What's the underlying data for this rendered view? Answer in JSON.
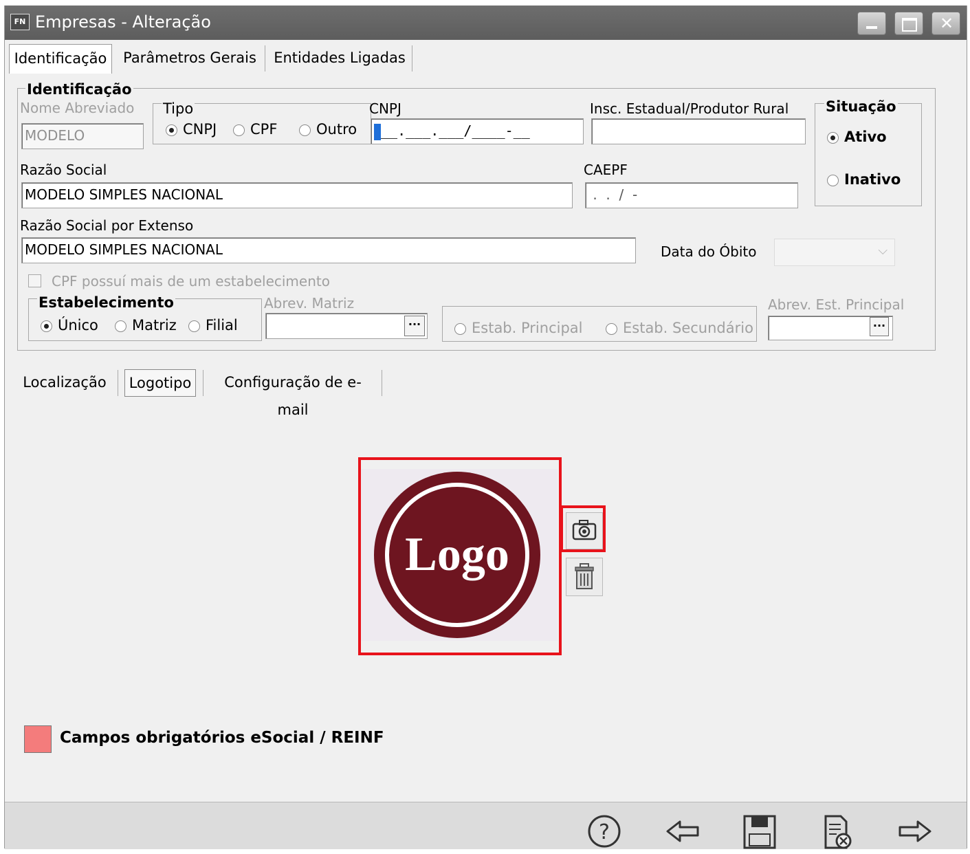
{
  "window": {
    "title": "Empresas - Alteração",
    "app_icon": "FN"
  },
  "tabs": [
    "Identificação",
    "Parâmetros Gerais",
    "Entidades Ligadas"
  ],
  "identificacao": {
    "legend": "Identificação",
    "nome_abreviado_label": "Nome Abreviado",
    "nome_abreviado_value": "MODELO",
    "tipo": {
      "legend": "Tipo",
      "options": [
        "CNPJ",
        "CPF",
        "Outro"
      ],
      "selected": "CNPJ"
    },
    "cnpj_label": "CNPJ",
    "cnpj_value": "__.___.___/____-__",
    "insc_label": "Insc. Estadual/Produtor Rural",
    "insc_value": "",
    "razao_label": "Razão Social",
    "razao_value": "MODELO SIMPLES NACIONAL",
    "caepf_label": "CAEPF",
    "caepf_value": " .  .  /  -",
    "razao_ext_label": "Razão Social por Extenso",
    "razao_ext_value": "MODELO SIMPLES NACIONAL",
    "data_obito_label": "Data do Óbito",
    "cpf_checkbox_label": "CPF possuí mais de um estabelecimento",
    "situacao": {
      "legend": "Situação",
      "options": [
        "Ativo",
        "Inativo"
      ],
      "selected": "Ativo"
    },
    "estabelecimento": {
      "legend": "Estabelecimento",
      "options": [
        "Único",
        "Matriz",
        "Filial"
      ],
      "selected": "Único"
    },
    "abrev_matriz_label": "Abrev. Matriz",
    "estab_options": [
      "Estab. Principal",
      "Estab. Secundário"
    ],
    "abrev_est_label": "Abrev. Est. Principal",
    "ellipsis": "···"
  },
  "subtabs": [
    "Localização",
    "Logotipo",
    "Configuração de e-mail"
  ],
  "logo": {
    "text": "Logo"
  },
  "legend_note": {
    "text": "Campos obrigatórios eSocial / REINF",
    "color": "#f47c7c"
  },
  "colors": {
    "highlight": "#e8131b",
    "logo_fill": "#6e1520"
  }
}
